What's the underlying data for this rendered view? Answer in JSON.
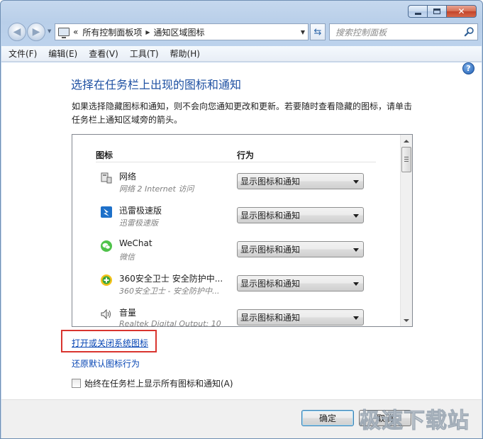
{
  "window": {
    "controls": {
      "minimize": "minimize",
      "maximize": "maximize",
      "close": "close"
    }
  },
  "address_bar": {
    "overflow": "«",
    "segments": [
      "所有控制面板项",
      "通知区域图标"
    ]
  },
  "search": {
    "placeholder": "搜索控制面板"
  },
  "menu": [
    "文件(F)",
    "编辑(E)",
    "查看(V)",
    "工具(T)",
    "帮助(H)"
  ],
  "help": "?",
  "page": {
    "title": "选择在任务栏上出现的图标和通知",
    "description": "如果选择隐藏图标和通知，则不会向您通知更改和更新。若要随时查看隐藏的图标，请单击任务栏上通知区域旁的箭头。"
  },
  "table": {
    "headers": {
      "icon": "图标",
      "behavior": "行为"
    },
    "rows": [
      {
        "name": "网络",
        "sub": "网络 2 Internet 访问",
        "behavior": "显示图标和通知",
        "icon": "network-icon"
      },
      {
        "name": "迅雷极速版",
        "sub": "迅雷极速版",
        "behavior": "显示图标和通知",
        "icon": "thunder-icon"
      },
      {
        "name": "WeChat",
        "sub": "微信",
        "behavior": "显示图标和通知",
        "icon": "wechat-icon"
      },
      {
        "name": "360安全卫士 安全防护中...",
        "sub": "360安全卫士 - 安全防护中...",
        "behavior": "显示图标和通知",
        "icon": "360-icon"
      },
      {
        "name": "音量",
        "sub": "Realtek Digital Output: 10",
        "behavior": "显示图标和通知",
        "icon": "speaker-icon"
      }
    ]
  },
  "links": {
    "toggle_system_icons": "打开或关闭系统图标",
    "restore_defaults": "还原默认图标行为"
  },
  "checkbox": {
    "label": "始终在任务栏上显示所有图标和通知(A)",
    "checked": false
  },
  "buttons": {
    "ok": "确定",
    "cancel": "取消"
  },
  "watermark": "极速下载站",
  "colors": {
    "title": "#1e50a2",
    "link": "#0645b4",
    "highlight": "#d9352f"
  }
}
